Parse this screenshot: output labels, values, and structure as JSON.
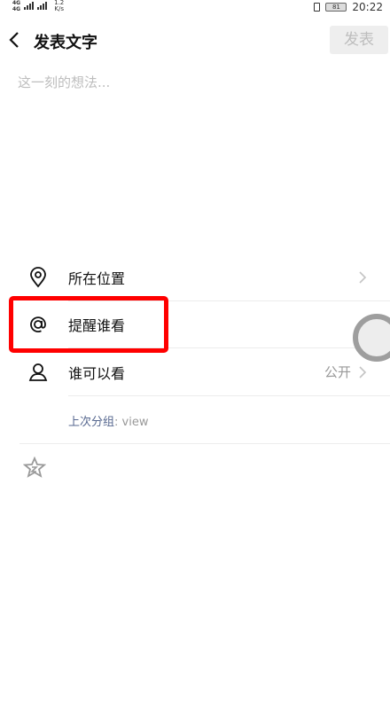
{
  "status_bar": {
    "sim1": "4G",
    "sim2": "4G",
    "speed_value": "1.2",
    "speed_unit": "K/s",
    "battery": "81",
    "time": "20:22"
  },
  "header": {
    "title": "发表文字",
    "publish_label": "发表"
  },
  "compose": {
    "placeholder": "这一刻的想法..."
  },
  "options": {
    "location": {
      "label": "所在位置",
      "icon": "location-pin-icon"
    },
    "remind": {
      "label": "提醒谁看",
      "icon": "at-icon"
    },
    "visibility": {
      "label": "谁可以看",
      "value": "公开",
      "icon": "person-icon"
    }
  },
  "last_group": {
    "label": "上次分组",
    "separator": ": ",
    "value": "view"
  },
  "colors": {
    "highlight": "#ff0000",
    "link_blue": "#56678f",
    "disabled_button_bg": "#eeeeee"
  }
}
